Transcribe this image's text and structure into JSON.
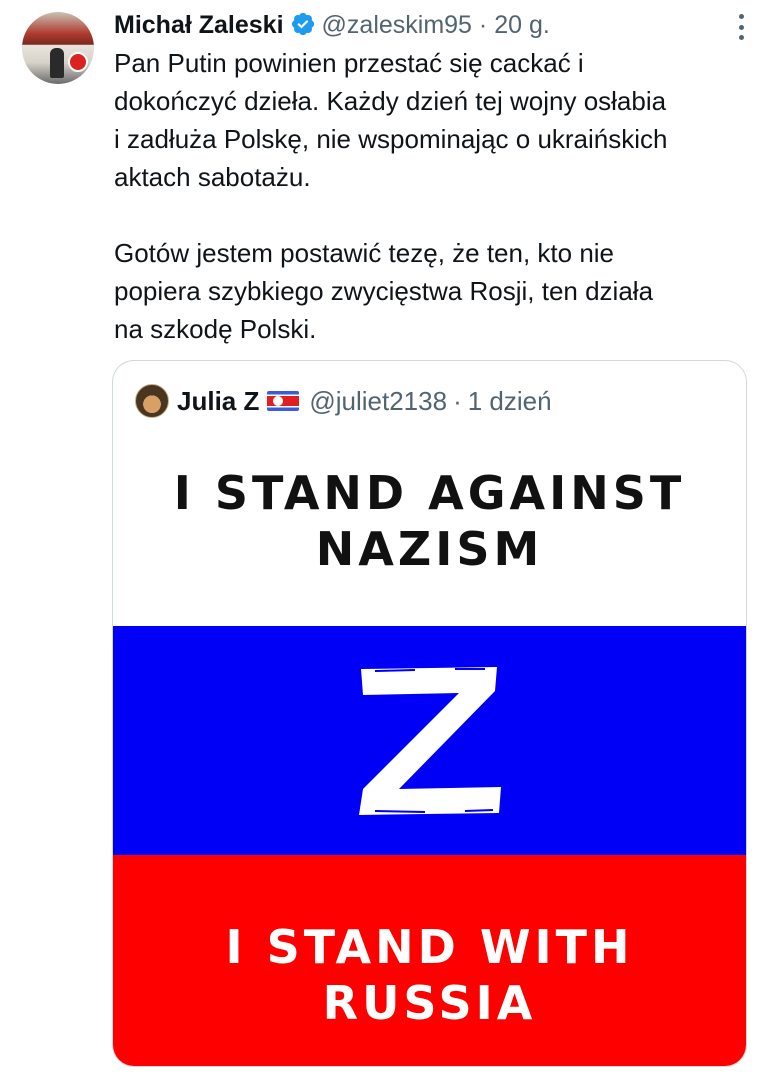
{
  "tweet": {
    "author_name": "Michał Zaleski",
    "handle": "@zaleskim95",
    "separator": "·",
    "time": "20 g.",
    "text": "Pan Putin powinien przestać się cackać i\ndokończyć dzieła. Każdy dzień tej wojny osłabia\ni zadłuża Polskę, nie wspominając o ukraińskich\naktach sabotażu.\n\nGotów jestem postawić tezę, że ten, kto nie\npopiera szybkiego zwycięstwa Rosji, ten działa\nna szkodę Polski."
  },
  "quote": {
    "author_name": "Julia Z",
    "handle": "@juliet2138",
    "separator": "·",
    "time": "1 dzień",
    "image": {
      "top_text": "I STAND AGAINST\nNAZISM",
      "symbol": "Z",
      "bottom_text": "I STAND WITH\nRUSSIA"
    }
  },
  "icons": {
    "verified": "verified-badge-icon",
    "more": "more-options-icon",
    "flag": "north-korea-flag-icon"
  },
  "colors": {
    "verified_blue": "#1d9bf0",
    "secondary_text": "#536471",
    "flag_white": "#ffffff",
    "flag_blue": "#0000f7",
    "flag_red": "#ff0000"
  }
}
